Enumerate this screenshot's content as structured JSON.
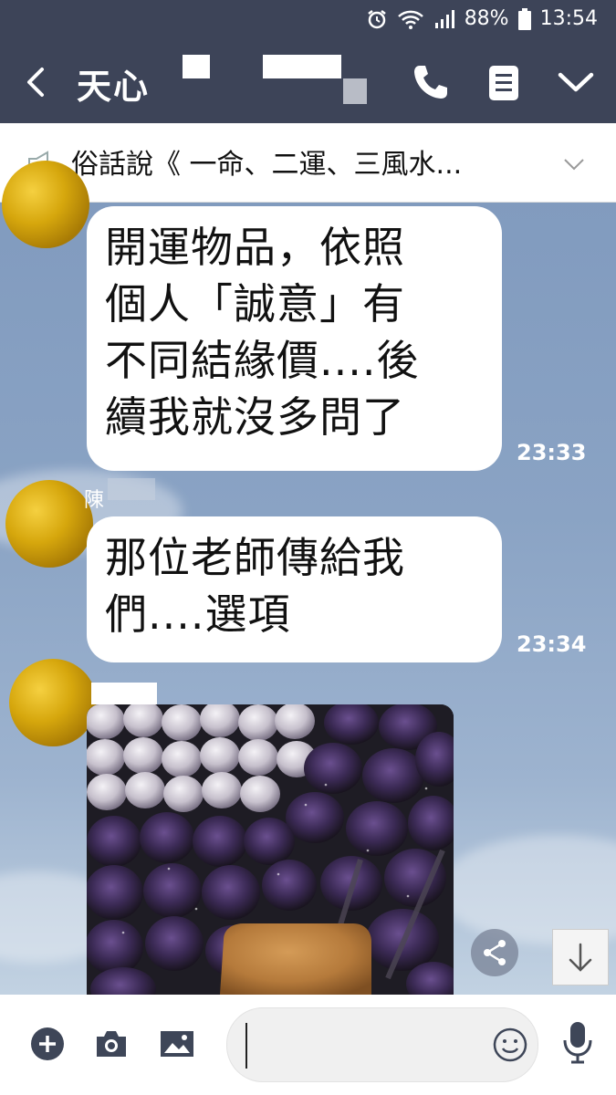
{
  "status_bar": {
    "battery": "88%",
    "time": "13:54"
  },
  "header": {
    "title": "天心"
  },
  "announcement": {
    "text": "俗話說《 一命、二運、三風水..."
  },
  "messages": [
    {
      "sender": "",
      "lines": [
        "開運物品，依照",
        "個人「誠意」有",
        "不同結緣價....後",
        "續我就沒多問了"
      ],
      "time": "23:33"
    },
    {
      "sender": "陳",
      "lines": [
        "那位老師傳給我",
        "們....選項"
      ],
      "time": "23:34"
    },
    {
      "sender": "",
      "type": "image",
      "description": ""
    }
  ],
  "input": {
    "value": ""
  },
  "icons": {
    "status": [
      "alarm-icon",
      "wifi-icon",
      "signal-icon",
      "battery-icon"
    ],
    "header": [
      "back-icon",
      "call-icon",
      "notes-icon",
      "chevron-down-icon"
    ],
    "bottom": [
      "add-icon",
      "camera-icon",
      "image-icon",
      "emoji-icon",
      "mic-icon"
    ]
  },
  "colors": {
    "header_bg": "#3d4458",
    "chat_bg": "#8aa3c4",
    "bubble_bg": "#ffffff",
    "avatar_gold": "#d6a70d"
  }
}
